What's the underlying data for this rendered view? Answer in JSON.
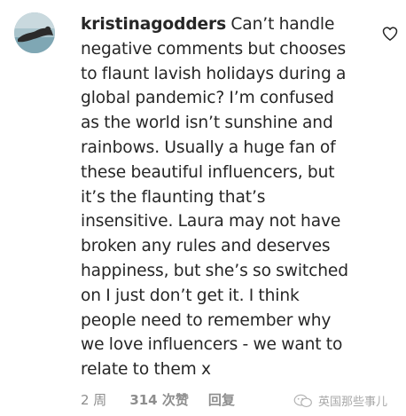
{
  "comment": {
    "username": "kristinagodders",
    "text": "Can’t handle negative comments but chooses to flaunt lavish holidays during a global pandemic? I’m confused as the world isn’t sunshine and rainbows. Usually a huge fan of these beautiful influencers, but it’s the flaunting that’s insensitive. Laura may not have broken any rules and deserves happiness, but she’s so switched on I just don’t get it. I think people need to remember why we love influencers - we want to relate to them x",
    "time": "2 周",
    "likes": "314 次赞",
    "reply_label": "回复"
  },
  "icons": {
    "like": "heart-outline-icon",
    "watermark": "wechat-icon"
  },
  "watermark": {
    "text": "英国那些事儿"
  },
  "colors": {
    "text": "#262626",
    "secondary": "#8e8e8e",
    "background": "#ffffff"
  }
}
